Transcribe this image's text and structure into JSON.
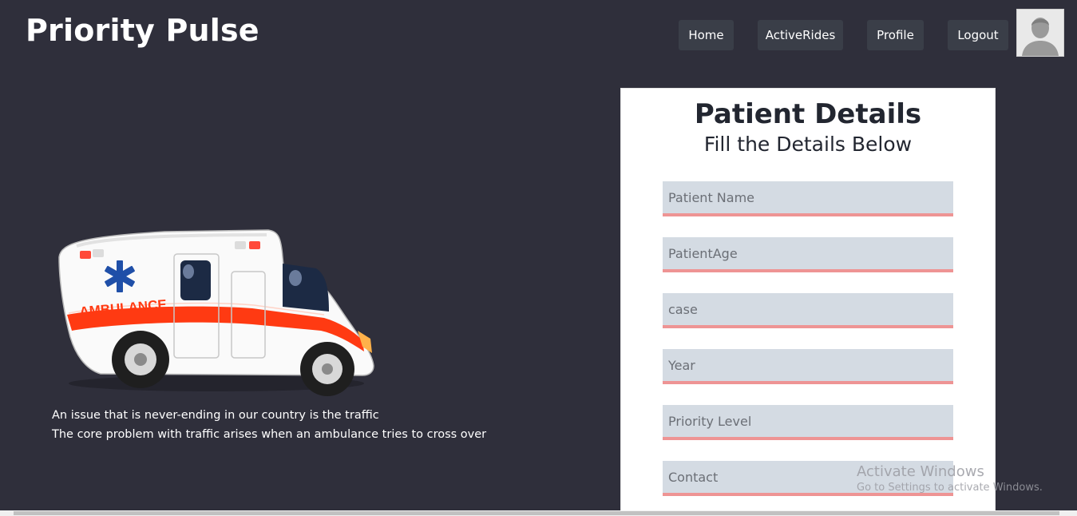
{
  "header": {
    "brand": "Priority Pulse",
    "nav": [
      "Home",
      "ActiveRides",
      "Profile",
      "Logout"
    ],
    "avatar_icon": "user-avatar-icon"
  },
  "hero": {
    "image_label": "AMBULANCE",
    "lines": [
      "An issue that is never-ending in our country is the traffic",
      "The core problem with traffic arises when an ambulance tries to cross over"
    ]
  },
  "form": {
    "title": "Patient Details",
    "subtitle": "Fill the Details Below",
    "fields": [
      {
        "placeholder": "Patient Name"
      },
      {
        "placeholder": "PatientAge"
      },
      {
        "placeholder": "case"
      },
      {
        "placeholder": "Year"
      },
      {
        "placeholder": "Priority Level"
      },
      {
        "placeholder": "Contact"
      }
    ]
  },
  "watermark": {
    "title": "Activate Windows",
    "subtitle": "Go to Settings to activate Windows."
  },
  "colors": {
    "background": "#2f2f3b",
    "nav_button": "#3a3e48",
    "field_bg": "#d4dbe3",
    "field_underline": "#ee9494",
    "ambulance_stripe": "#ff3a12",
    "star_of_life": "#1f4fa8"
  }
}
